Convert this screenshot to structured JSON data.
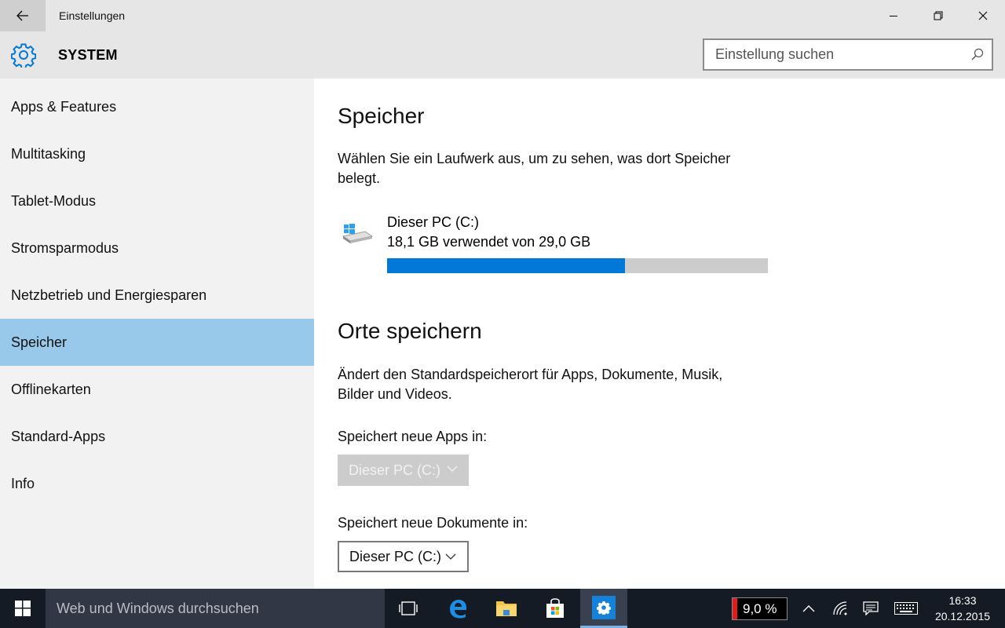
{
  "window": {
    "title": "Einstellungen"
  },
  "header": {
    "title": "SYSTEM",
    "search_placeholder": "Einstellung suchen"
  },
  "sidebar": {
    "items": [
      {
        "label": "Apps & Features"
      },
      {
        "label": "Multitasking"
      },
      {
        "label": "Tablet-Modus"
      },
      {
        "label": "Stromsparmodus"
      },
      {
        "label": "Netzbetrieb und Energiesparen"
      },
      {
        "label": "Speicher",
        "selected": true
      },
      {
        "label": "Offlinekarten"
      },
      {
        "label": "Standard-Apps"
      },
      {
        "label": "Info"
      }
    ]
  },
  "main": {
    "storage": {
      "heading": "Speicher",
      "description": "Wählen Sie ein Laufwerk aus, um zu sehen, was dort Speicher belegt.",
      "drive": {
        "name": "Dieser PC (C:)",
        "usage_text": "18,1 GB verwendet von 29,0 GB",
        "used_fraction": 0.624
      }
    },
    "save_locations": {
      "heading": "Orte speichern",
      "description": "Ändert den Standardspeicherort für Apps, Dokumente, Musik, Bilder und Videos.",
      "apps_label": "Speichert neue Apps in:",
      "apps_value": "Dieser PC (C:)",
      "docs_label": "Speichert neue Dokumente in:",
      "docs_value": "Dieser PC (C:)"
    }
  },
  "taskbar": {
    "search_text": "Web und Windows durchsuchen",
    "cpu_usage": "9,0 %",
    "time": "16:33",
    "date": "20.12.2015"
  },
  "colors": {
    "accent": "#0078d7",
    "selection": "#99c9ea",
    "taskbar": "#151b24"
  }
}
